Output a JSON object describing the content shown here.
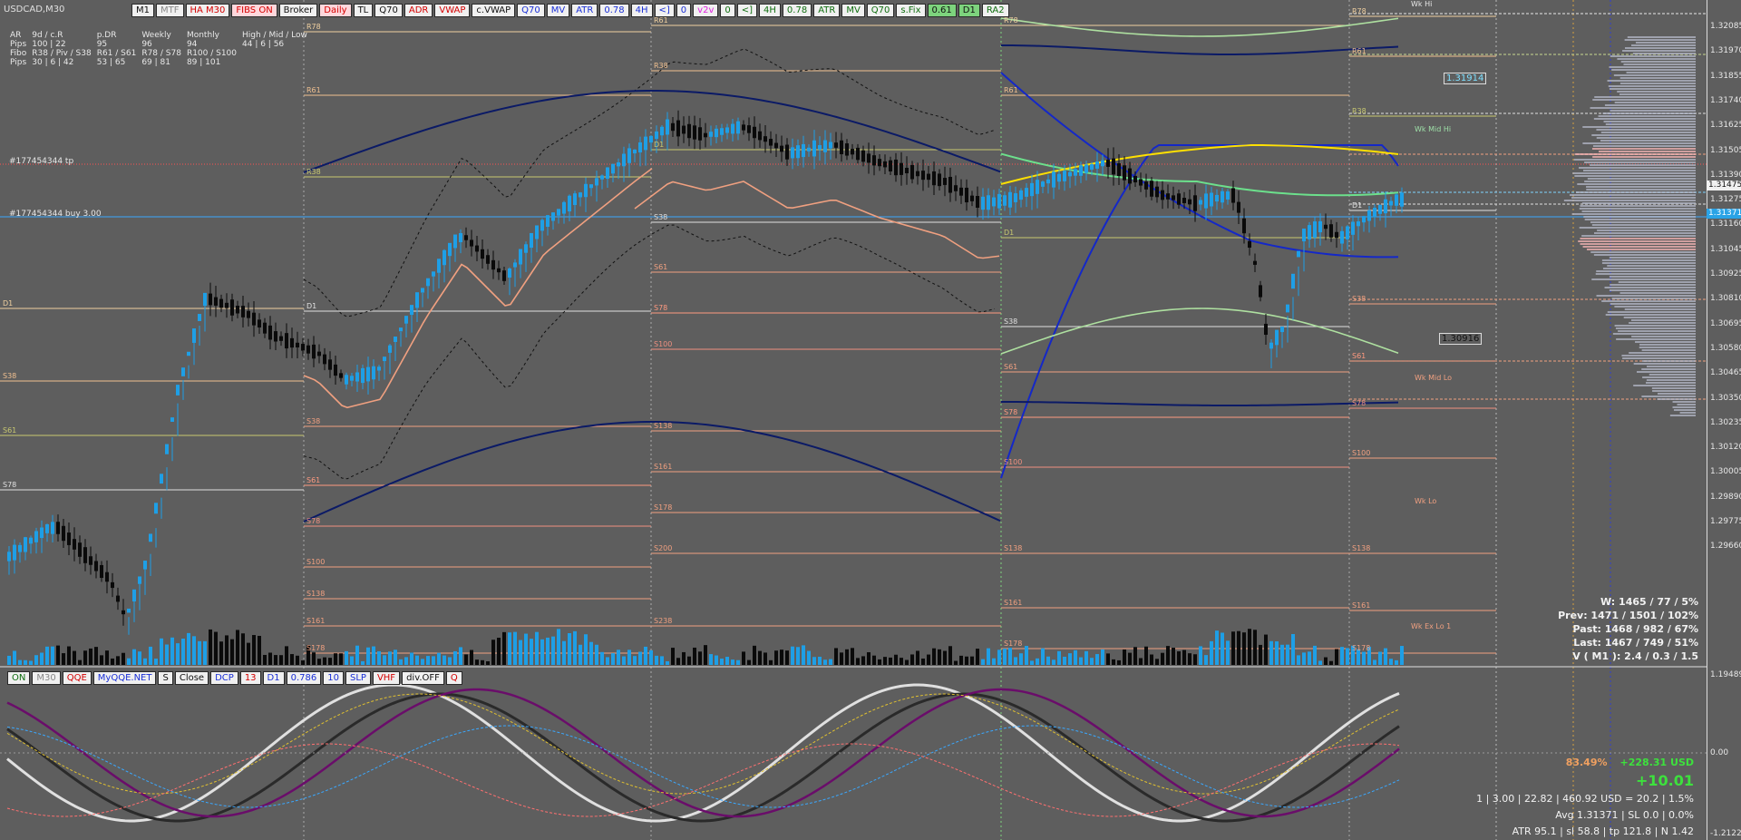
{
  "symbol": "USDCAD,M30",
  "top_toolbar": [
    {
      "label": "M1",
      "style": "white",
      "color": "black"
    },
    {
      "label": "MTF",
      "style": "white",
      "color": "gray"
    },
    {
      "label": "HA M30",
      "style": "white",
      "color": "red"
    },
    {
      "label": "FIBS ON",
      "style": "pink",
      "color": "red"
    },
    {
      "label": "Broker",
      "style": "white",
      "color": "black"
    },
    {
      "label": "Daily",
      "style": "pink",
      "color": "red"
    },
    {
      "label": "TL",
      "style": "white",
      "color": "black"
    },
    {
      "label": "Q70",
      "style": "white",
      "color": "black"
    },
    {
      "label": "ADR",
      "style": "white",
      "color": "red"
    },
    {
      "label": "VWAP",
      "style": "white",
      "color": "red"
    },
    {
      "label": "c.VWAP",
      "style": "white",
      "color": "black"
    },
    {
      "label": "Q70",
      "style": "white",
      "color": "blue"
    },
    {
      "label": "MV",
      "style": "white",
      "color": "blue"
    },
    {
      "label": "ATR",
      "style": "white",
      "color": "blue"
    },
    {
      "label": "0.78",
      "style": "white",
      "color": "blue"
    },
    {
      "label": "4H",
      "style": "white",
      "color": "blue"
    },
    {
      "label": "<]",
      "style": "white",
      "color": "blue"
    },
    {
      "label": "0",
      "style": "white",
      "color": "blue"
    },
    {
      "label": "v2v",
      "style": "white",
      "color": "magenta"
    },
    {
      "label": "0",
      "style": "white",
      "color": "green"
    },
    {
      "label": "<]",
      "style": "white",
      "color": "green"
    },
    {
      "label": "4H",
      "style": "white",
      "color": "green"
    },
    {
      "label": "0.78",
      "style": "white",
      "color": "green"
    },
    {
      "label": "ATR",
      "style": "white",
      "color": "green"
    },
    {
      "label": "MV",
      "style": "white",
      "color": "green"
    },
    {
      "label": "Q70",
      "style": "white",
      "color": "green"
    },
    {
      "label": "s.Fix",
      "style": "white",
      "color": "green"
    },
    {
      "label": "0.61",
      "style": "lime",
      "color": "black"
    },
    {
      "label": "D1",
      "style": "lime",
      "color": "black"
    },
    {
      "label": "RA2",
      "style": "white",
      "color": "green"
    }
  ],
  "stats": {
    "header": [
      "AR",
      "9d / c.R",
      "p.DR",
      "Weekly",
      "Monthly",
      "High / Mid / Low"
    ],
    "pips_row": [
      "Pips",
      "100 | 22",
      "95",
      "96",
      "94",
      "44 | 6 | 56"
    ],
    "fibo_header": [
      "Fibo",
      "R38 / Piv / S38",
      "R61 / S61",
      "R78 / S78",
      "R100 / S100"
    ],
    "fibo_row": [
      "Pips",
      "30 | 6 | 42",
      "53 | 65",
      "69 | 81",
      "89 | 101"
    ]
  },
  "orders": {
    "tp": "#177454344 tp",
    "buy": "#177454344 buy 3.00"
  },
  "price_axis": [
    "1.32085",
    "1.31970",
    "1.31855",
    "1.31740",
    "1.31625",
    "1.31505",
    "1.31390",
    "1.31275",
    "1.31160",
    "1.31045",
    "1.30925",
    "1.30810",
    "1.30695",
    "1.30580",
    "1.30465",
    "1.30350",
    "1.30235",
    "1.30120",
    "1.30005",
    "1.29890",
    "1.29775",
    "1.29660"
  ],
  "price_tags": [
    {
      "label": "1.31475",
      "bg": "#f0f0f0",
      "color": "#111"
    },
    {
      "label": "1.31371",
      "bg": "#2aa3e6",
      "color": "#fff"
    }
  ],
  "boxed_levels": [
    {
      "label": "1.31914",
      "color": "#7fe0ff"
    },
    {
      "label": "1.30916",
      "color": "#111"
    }
  ],
  "weekly_labels": [
    "Wk Hi",
    "Wk Mid Hi",
    "Wk Mid Lo",
    "Wk Lo",
    "Wk Ex Lo 1"
  ],
  "fib_labels": {
    "seg0": [
      "D1",
      "S38",
      "S61",
      "S78"
    ],
    "seg1": [
      "R78",
      "R61",
      "R38",
      "D1",
      "S38",
      "S61",
      "S78",
      "S100",
      "S138",
      "S161",
      "S178"
    ],
    "seg2": [
      "R61",
      "R38",
      "D1",
      "S38",
      "S61",
      "S78",
      "S100",
      "S138",
      "S161",
      "S178",
      "S200",
      "S238"
    ],
    "seg3": [
      "R78",
      "R61",
      "D1",
      "S38",
      "S61",
      "S78",
      "S100",
      "S138",
      "S161",
      "S178"
    ],
    "seg4": [
      "R78",
      "R61",
      "R38",
      "D1",
      "S38",
      "S61",
      "S78",
      "S100",
      "S138",
      "S161",
      "S178"
    ]
  },
  "summary": [
    "W: 1465 / 77 / 5%",
    "Prev: 1471 / 1501 / 102%",
    "Past: 1468 / 982 / 67%",
    "Last: 1467 / 749 / 51%",
    "V ( M1 ): 2.4 / 0.3 / 1.5"
  ],
  "osc_toolbar": [
    {
      "label": "ON",
      "style": "white",
      "color": "green"
    },
    {
      "label": "M30",
      "style": "white",
      "color": "gray"
    },
    {
      "label": "QQE",
      "style": "white",
      "color": "red"
    },
    {
      "label": "MyQQE.NET",
      "style": "white",
      "color": "blue"
    },
    {
      "label": "S",
      "style": "white",
      "color": "black"
    },
    {
      "label": "Close",
      "style": "white",
      "color": "black"
    },
    {
      "label": "DCP",
      "style": "white",
      "color": "blue"
    },
    {
      "label": "13",
      "style": "white",
      "color": "red"
    },
    {
      "label": "D1",
      "style": "white",
      "color": "blue"
    },
    {
      "label": "0.786",
      "style": "white",
      "color": "blue"
    },
    {
      "label": "10",
      "style": "white",
      "color": "blue"
    },
    {
      "label": "SLP",
      "style": "white",
      "color": "blue"
    },
    {
      "label": "VHF",
      "style": "white",
      "color": "red"
    },
    {
      "label": "div.OFF",
      "style": "white",
      "color": "black"
    },
    {
      "label": "Q",
      "style": "white",
      "color": "red"
    }
  ],
  "osc_axis": [
    "1.19489",
    "0.00",
    "-1.2122"
  ],
  "account": {
    "percent": "83.49%",
    "usd": "+228.31 USD",
    "pnl": "+10.01",
    "line1": "1  |  3.00  |  22.82  |  460.92 USD = 20.2  |  1.5%",
    "line2": "Avg 1.31371  |  SL 0.0  |  0.0%",
    "line3": "ATR 95.1  |  sl 58.8  |  tp 121.8  |  N 1.42"
  },
  "colors": {
    "background": "#5e5e5e",
    "bull": "#1e9fe6",
    "bear": "#0a0a0a",
    "ma_blue": "#0a1fb4",
    "ma_navy": "#0b1a66",
    "ma_salmon": "#f0a080",
    "ma_yellow": "#ffe000",
    "band_green": "#aee0a0"
  }
}
